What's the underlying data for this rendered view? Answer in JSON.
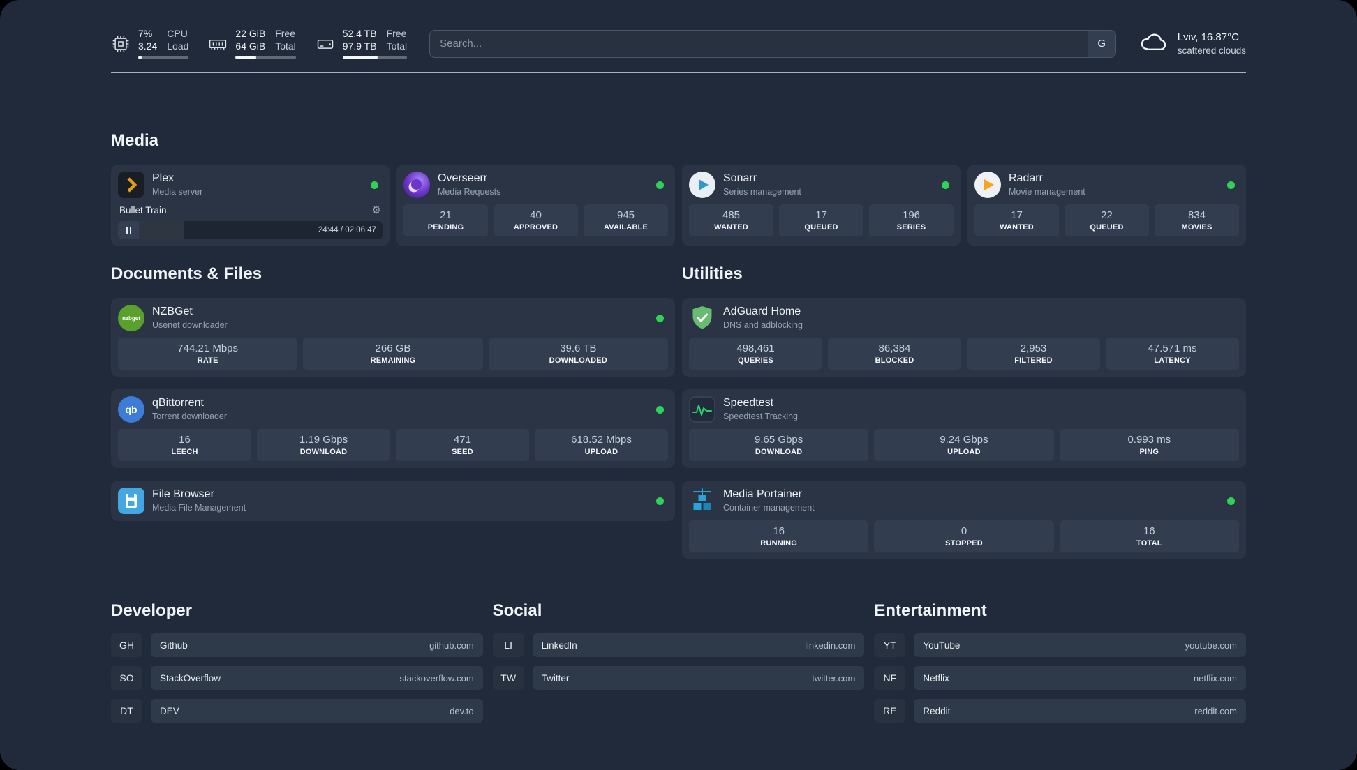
{
  "header": {
    "cpu": {
      "usage": "7%",
      "usage_label": "CPU",
      "load": "3.24",
      "load_label": "Load"
    },
    "memory": {
      "free": "22 GiB",
      "free_label": "Free",
      "total": "64 GiB",
      "total_label": "Total"
    },
    "storage": {
      "free": "52.4 TB",
      "free_label": "Free",
      "total": "97.9 TB",
      "total_label": "Total"
    },
    "search": {
      "placeholder": "Search...",
      "provider": "G"
    },
    "weather": {
      "location": "Lviv, 16.87°C",
      "condition": "scattered clouds"
    }
  },
  "media": {
    "title": "Media",
    "plex": {
      "name": "Plex",
      "desc": "Media server",
      "now_playing": "Bullet Train",
      "time": "24:44 / 02:06:47"
    },
    "overseerr": {
      "name": "Overseerr",
      "desc": "Media Requests",
      "stats": [
        {
          "value": "21",
          "label": "PENDING"
        },
        {
          "value": "40",
          "label": "APPROVED"
        },
        {
          "value": "945",
          "label": "AVAILABLE"
        }
      ]
    },
    "sonarr": {
      "name": "Sonarr",
      "desc": "Series management",
      "stats": [
        {
          "value": "485",
          "label": "WANTED"
        },
        {
          "value": "17",
          "label": "QUEUED"
        },
        {
          "value": "196",
          "label": "SERIES"
        }
      ]
    },
    "radarr": {
      "name": "Radarr",
      "desc": "Movie management",
      "stats": [
        {
          "value": "17",
          "label": "WANTED"
        },
        {
          "value": "22",
          "label": "QUEUED"
        },
        {
          "value": "834",
          "label": "MOVIES"
        }
      ]
    }
  },
  "documents": {
    "title": "Documents & Files",
    "nzbget": {
      "name": "NZBGet",
      "desc": "Usenet downloader",
      "icon_text": "nzbget",
      "stats": [
        {
          "value": "744.21 Mbps",
          "label": "RATE"
        },
        {
          "value": "266 GB",
          "label": "REMAINING"
        },
        {
          "value": "39.6 TB",
          "label": "DOWNLOADED"
        }
      ]
    },
    "qbittorrent": {
      "name": "qBittorrent",
      "desc": "Torrent downloader",
      "icon_text": "qb",
      "stats": [
        {
          "value": "16",
          "label": "LEECH"
        },
        {
          "value": "1.19 Gbps",
          "label": "DOWNLOAD"
        },
        {
          "value": "471",
          "label": "SEED"
        },
        {
          "value": "618.52 Mbps",
          "label": "UPLOAD"
        }
      ]
    },
    "filebrowser": {
      "name": "File Browser",
      "desc": "Media File Management"
    }
  },
  "utilities": {
    "title": "Utilities",
    "adguard": {
      "name": "AdGuard Home",
      "desc": "DNS and adblocking",
      "stats": [
        {
          "value": "498,461",
          "label": "QUERIES"
        },
        {
          "value": "86,384",
          "label": "BLOCKED"
        },
        {
          "value": "2,953",
          "label": "FILTERED"
        },
        {
          "value": "47.571 ms",
          "label": "LATENCY"
        }
      ]
    },
    "speedtest": {
      "name": "Speedtest",
      "desc": "Speedtest Tracking",
      "stats": [
        {
          "value": "9.65 Gbps",
          "label": "DOWNLOAD"
        },
        {
          "value": "9.24 Gbps",
          "label": "UPLOAD"
        },
        {
          "value": "0.993 ms",
          "label": "PING"
        }
      ]
    },
    "portainer": {
      "name": "Media Portainer",
      "desc": "Container management",
      "stats": [
        {
          "value": "16",
          "label": "RUNNING"
        },
        {
          "value": "0",
          "label": "STOPPED"
        },
        {
          "value": "16",
          "label": "TOTAL"
        }
      ]
    }
  },
  "bookmarks": {
    "developer": {
      "title": "Developer",
      "items": [
        {
          "abbr": "GH",
          "name": "Github",
          "url": "github.com"
        },
        {
          "abbr": "SO",
          "name": "StackOverflow",
          "url": "stackoverflow.com"
        },
        {
          "abbr": "DT",
          "name": "DEV",
          "url": "dev.to"
        }
      ]
    },
    "social": {
      "title": "Social",
      "items": [
        {
          "abbr": "LI",
          "name": "LinkedIn",
          "url": "linkedin.com"
        },
        {
          "abbr": "TW",
          "name": "Twitter",
          "url": "twitter.com"
        }
      ]
    },
    "entertainment": {
      "title": "Entertainment",
      "items": [
        {
          "abbr": "YT",
          "name": "YouTube",
          "url": "youtube.com"
        },
        {
          "abbr": "NF",
          "name": "Netflix",
          "url": "netflix.com"
        },
        {
          "abbr": "RE",
          "name": "Reddit",
          "url": "reddit.com"
        }
      ]
    }
  }
}
